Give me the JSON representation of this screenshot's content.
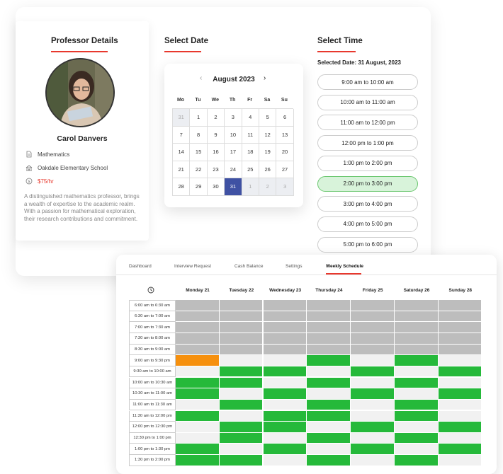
{
  "professor": {
    "section_title": "Professor Details",
    "name": "Carol Danvers",
    "subject": "Mathematics",
    "school": "Oakdale Elementary School",
    "rate": "$75/hr",
    "bio": "A distinguished mathematics professor, brings a wealth of expertise to the academic realm. With a passion for mathematical exploration, their research contributions and commitment."
  },
  "calendar": {
    "section_title": "Select Date",
    "month_label": "August 2023",
    "prev_icon": "chevron-left-icon",
    "next_icon": "chevron-right-icon",
    "weekdays": [
      "Mo",
      "Tu",
      "We",
      "Th",
      "Fr",
      "Sa",
      "Su"
    ],
    "days": [
      {
        "d": "31",
        "s": "other"
      },
      {
        "d": "1",
        "s": ""
      },
      {
        "d": "2",
        "s": ""
      },
      {
        "d": "3",
        "s": ""
      },
      {
        "d": "4",
        "s": ""
      },
      {
        "d": "5",
        "s": ""
      },
      {
        "d": "6",
        "s": ""
      },
      {
        "d": "7",
        "s": ""
      },
      {
        "d": "8",
        "s": ""
      },
      {
        "d": "9",
        "s": ""
      },
      {
        "d": "10",
        "s": ""
      },
      {
        "d": "11",
        "s": ""
      },
      {
        "d": "12",
        "s": ""
      },
      {
        "d": "13",
        "s": ""
      },
      {
        "d": "14",
        "s": ""
      },
      {
        "d": "15",
        "s": ""
      },
      {
        "d": "16",
        "s": ""
      },
      {
        "d": "17",
        "s": ""
      },
      {
        "d": "18",
        "s": ""
      },
      {
        "d": "19",
        "s": ""
      },
      {
        "d": "20",
        "s": ""
      },
      {
        "d": "21",
        "s": ""
      },
      {
        "d": "22",
        "s": ""
      },
      {
        "d": "23",
        "s": ""
      },
      {
        "d": "24",
        "s": ""
      },
      {
        "d": "25",
        "s": ""
      },
      {
        "d": "26",
        "s": ""
      },
      {
        "d": "27",
        "s": ""
      },
      {
        "d": "28",
        "s": ""
      },
      {
        "d": "29",
        "s": ""
      },
      {
        "d": "30",
        "s": ""
      },
      {
        "d": "31",
        "s": "sel"
      },
      {
        "d": "1",
        "s": "other"
      },
      {
        "d": "2",
        "s": "other"
      },
      {
        "d": "3",
        "s": "other"
      }
    ]
  },
  "time": {
    "section_title": "Select Time",
    "selected_date_label": "Selected Date: 31 August, 2023",
    "slots": [
      {
        "label": "9:00 am to 10:00 am",
        "active": false
      },
      {
        "label": "10:00 am to 11:00 am",
        "active": false
      },
      {
        "label": "11:00 am to 12:00 pm",
        "active": false
      },
      {
        "label": "12:00 pm to 1:00 pm",
        "active": false
      },
      {
        "label": "1:00 pm to 2:00 pm",
        "active": false
      },
      {
        "label": "2:00 pm to 3:00 pm",
        "active": true
      },
      {
        "label": "3:00 pm to 4:00 pm",
        "active": false
      },
      {
        "label": "4:00 pm to 5:00 pm",
        "active": false
      },
      {
        "label": "5:00 pm to 6:00 pm",
        "active": false
      }
    ]
  },
  "schedule": {
    "tabs": [
      {
        "label": "Dashboard",
        "active": false
      },
      {
        "label": "Interview Request",
        "active": false
      },
      {
        "label": "Cash Balance",
        "active": false
      },
      {
        "label": "Settings",
        "active": false
      },
      {
        "label": "Weekly Schedule",
        "active": true
      }
    ],
    "clock_icon": "clock-icon",
    "days": [
      "Monday 21",
      "Tuesday 22",
      "Wednesday 23",
      "Thursday 24",
      "Friday 25",
      "Saturday 26",
      "Sunday 28"
    ],
    "legend_colors": {
      "blocked": "#bdbdbd",
      "free": "#f1f1f1",
      "open": "#25b93a",
      "booked": "#f6900e"
    },
    "rows": [
      {
        "time": "6:00 am to 6:30 am",
        "slots": [
          "blocked",
          "blocked",
          "blocked",
          "blocked",
          "blocked",
          "blocked",
          "blocked"
        ]
      },
      {
        "time": "6:30 am to 7:00 am",
        "slots": [
          "blocked",
          "blocked",
          "blocked",
          "blocked",
          "blocked",
          "blocked",
          "blocked"
        ]
      },
      {
        "time": "7:00 am to 7:30 am",
        "slots": [
          "blocked",
          "blocked",
          "blocked",
          "blocked",
          "blocked",
          "blocked",
          "blocked"
        ]
      },
      {
        "time": "7:30 am to 8:00 am",
        "slots": [
          "blocked",
          "blocked",
          "blocked",
          "blocked",
          "blocked",
          "blocked",
          "blocked"
        ]
      },
      {
        "time": "8:30 am to 9:00 am",
        "slots": [
          "blocked",
          "blocked",
          "blocked",
          "blocked",
          "blocked",
          "blocked",
          "blocked"
        ]
      },
      {
        "time": "9:00 am to 9:30 pm",
        "slots": [
          "booked",
          "free",
          "free",
          "open",
          "free",
          "open",
          "free"
        ]
      },
      {
        "time": "9:30 am to 10:00 am",
        "slots": [
          "free",
          "open",
          "open",
          "free",
          "open",
          "free",
          "open"
        ]
      },
      {
        "time": "10:00 am to 10:30 am",
        "slots": [
          "open",
          "open",
          "free",
          "open",
          "free",
          "open",
          "free"
        ]
      },
      {
        "time": "10:30 am to 11:00 am",
        "slots": [
          "open",
          "free",
          "open",
          "free",
          "open",
          "free",
          "open"
        ]
      },
      {
        "time": "11:00 am to 11:30 am",
        "slots": [
          "free",
          "open",
          "free",
          "open",
          "free",
          "open",
          "free"
        ]
      },
      {
        "time": "11:30 am to 12:00 pm",
        "slots": [
          "open",
          "free",
          "open",
          "open",
          "free",
          "open",
          "free"
        ]
      },
      {
        "time": "12:00 pm to 12:30 pm",
        "slots": [
          "free",
          "open",
          "open",
          "free",
          "open",
          "free",
          "open"
        ]
      },
      {
        "time": "12:30 pm to 1:00 pm",
        "slots": [
          "free",
          "open",
          "free",
          "open",
          "free",
          "open",
          "free"
        ]
      },
      {
        "time": "1:00 pm to 1:30 pm",
        "slots": [
          "open",
          "free",
          "open",
          "free",
          "open",
          "free",
          "open"
        ]
      },
      {
        "time": "1:30 pm to 2:00 pm",
        "slots": [
          "open",
          "open",
          "free",
          "open",
          "free",
          "open",
          "free"
        ]
      }
    ]
  }
}
